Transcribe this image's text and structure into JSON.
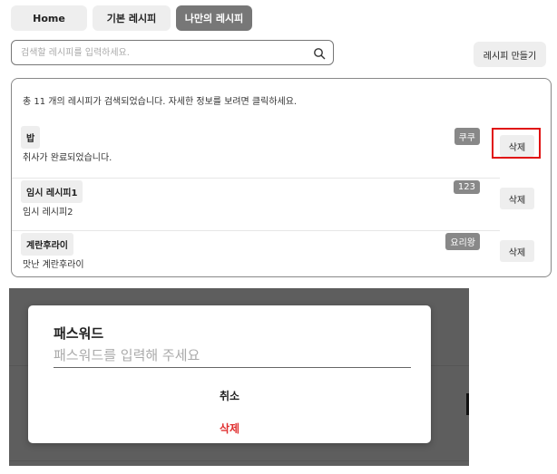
{
  "tabs": [
    {
      "label": "Home"
    },
    {
      "label": "기본 레시피"
    },
    {
      "label": "나만의 레시피"
    }
  ],
  "search": {
    "placeholder": "검색할 레시피를 입력하세요.",
    "icon": "search-icon"
  },
  "make_button": "레시피 만들기",
  "summary": "총 11 개의 레시피가 검색되었습니다. 자세한 정보를 보려면 클릭하세요.",
  "recipes": [
    {
      "title": "밥",
      "desc": "취사가 완료되었습니다.",
      "author": "쿠쿠",
      "delete": "삭제"
    },
    {
      "title": "임시 레시피1",
      "desc": "임시 레시피2",
      "author": "123",
      "delete": "삭제"
    },
    {
      "title": "계란후라이",
      "desc": "맛난 계란후라이",
      "author": "요리왕",
      "delete": "삭제"
    }
  ],
  "dialog": {
    "title": "패스워드",
    "placeholder": "패스워드를 입력해 주세요",
    "cancel": "취소",
    "delete": "삭제"
  },
  "colors": {
    "highlight": "#e01010",
    "danger": "#e03030",
    "active_tab": "#777777"
  }
}
